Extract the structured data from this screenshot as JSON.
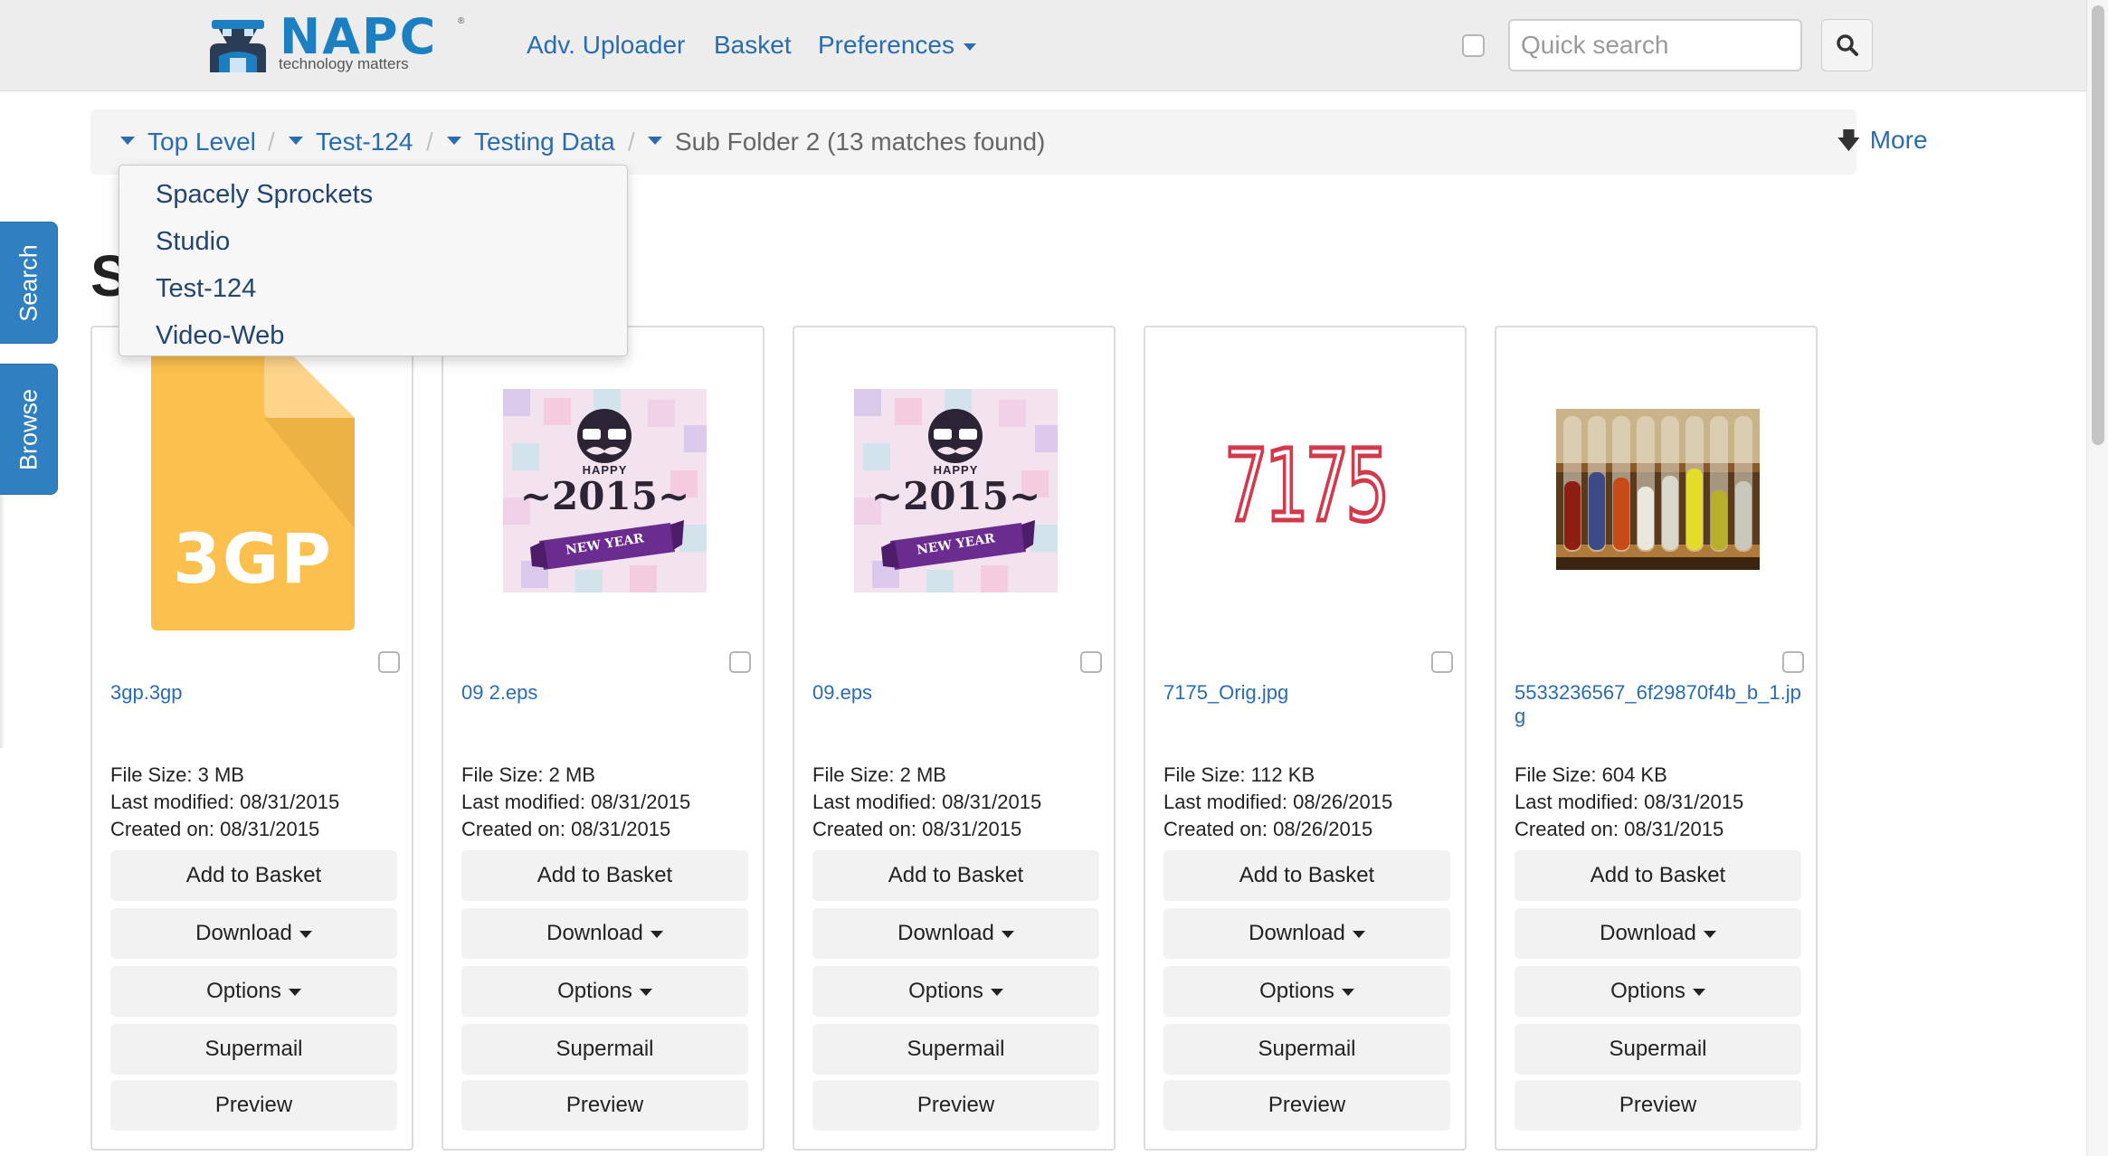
{
  "header": {
    "logo": {
      "word": "NAPC",
      "tagline": "technology matters"
    },
    "nav": {
      "uploader": "Adv. Uploader",
      "basket": "Basket",
      "preferences": "Preferences"
    },
    "search_placeholder": "Quick search"
  },
  "side_tabs": {
    "search": "Search",
    "browse": "Browse"
  },
  "breadcrumb": {
    "items": [
      "Top Level",
      "Test-124",
      "Testing Data"
    ],
    "separator": "/",
    "current": "Sub Folder 2 (13 matches found)",
    "more": "More"
  },
  "dropdown": {
    "items": [
      "Spacely Sprockets",
      "Studio",
      "Test-124",
      "Video-Web"
    ]
  },
  "page_heading": "S",
  "labels": {
    "size": "File Size: ",
    "modified": "Last modified: ",
    "created": "Created on: "
  },
  "buttons": {
    "add_to_basket": "Add to Basket",
    "download": "Download",
    "options": "Options",
    "supermail": "Supermail",
    "preview": "Preview"
  },
  "assets": [
    {
      "name": "3gp.3gp",
      "size": "3 MB",
      "modified": "08/31/2015",
      "created": "08/31/2015",
      "thumb_label": "3GP"
    },
    {
      "name": "09 2.eps",
      "size": "2 MB",
      "modified": "08/31/2015",
      "created": "08/31/2015",
      "thumb_happy": "HAPPY",
      "thumb_year": "~2015~",
      "thumb_banner": "NEW YEAR"
    },
    {
      "name": "09.eps",
      "size": "2 MB",
      "modified": "08/31/2015",
      "created": "08/31/2015",
      "thumb_happy": "HAPPY",
      "thumb_year": "~2015~",
      "thumb_banner": "NEW YEAR"
    },
    {
      "name": "7175_Orig.jpg",
      "size": "112 KB",
      "modified": "08/26/2015",
      "created": "08/26/2015",
      "thumb_text": "7175"
    },
    {
      "name": "5533236567_6f29870f4b_b_1.jpg",
      "size": "604 KB",
      "modified": "08/31/2015",
      "created": "08/31/2015"
    }
  ],
  "colors": {
    "link": "#2a6cb0",
    "side_tab": "#2f7fc1",
    "logo_blue": "#1b7fc1",
    "file_icon": "#fbc04d",
    "number_red": "#d23a4c"
  }
}
